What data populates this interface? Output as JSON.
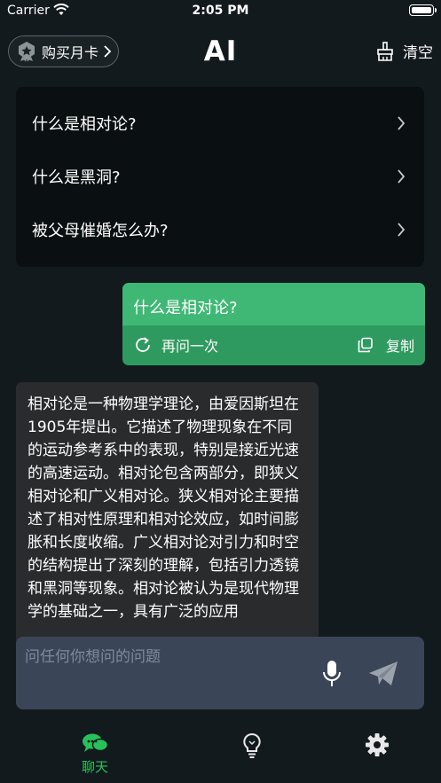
{
  "status_bar": {
    "carrier": "Carrier",
    "time": "2:05 PM"
  },
  "header": {
    "month_card_label": "购买月卡",
    "title": "AI",
    "clear_label": "清空"
  },
  "suggestions": [
    {
      "text": "什么是相对论?"
    },
    {
      "text": "什么是黑洞?"
    },
    {
      "text": "被父母催婚怎么办?"
    }
  ],
  "user_message": {
    "text": "什么是相对论?",
    "retry_label": "再问一次",
    "copy_label": "复制"
  },
  "ai_message": {
    "text": "相对论是一种物理学理论，由爱因斯坦在1905年提出。它描述了物理现象在不同的运动参考系中的表现，特别是接近光速的高速运动。相对论包含两部分，即狭义相对论和广义相对论。狭义相对论主要描述了相对性原理和相对论效应，如时间膨胀和长度收缩。广义相对论对引力和时空的结构提出了深刻的理解，包括引力透镜和黑洞等现象。相对论被认为是现代物理学的基础之一，具有广泛的应用"
  },
  "input": {
    "placeholder": "问任何你想问的问题",
    "value": ""
  },
  "tabs": [
    {
      "icon": "chat-icon",
      "label": "聊天",
      "active": true
    },
    {
      "icon": "lightbulb-icon"
    },
    {
      "icon": "gear-icon"
    }
  ],
  "colors": {
    "background": "#131a1e",
    "user_bubble": "#3fb875",
    "user_bubble_actions": "#2f9a5f",
    "ai_bubble": "#2a2b2d",
    "input_bar": "#3a4658",
    "active_tab": "#27c05a"
  }
}
